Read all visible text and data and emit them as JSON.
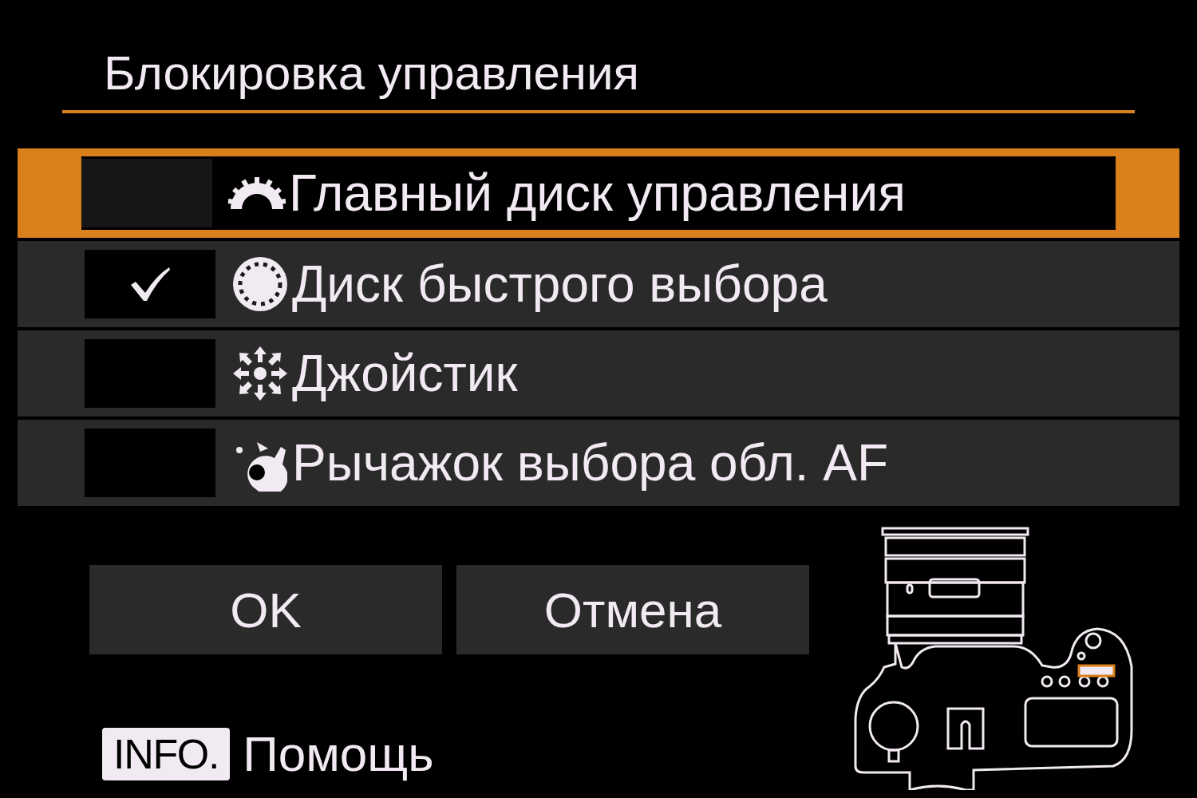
{
  "title": "Блокировка управления",
  "items": [
    {
      "kind": "main-dial",
      "label": "Главный диск управления",
      "selected": true,
      "checked": false
    },
    {
      "kind": "quick-dial",
      "label": "Диск быстрого выбора",
      "selected": false,
      "checked": true
    },
    {
      "kind": "joystick",
      "label": "Джойстик",
      "selected": false,
      "checked": false
    },
    {
      "kind": "af-lever",
      "label": "Рычажок выбора обл. AF",
      "selected": false,
      "checked": false
    }
  ],
  "buttons": [
    "OK",
    "Отмена"
  ],
  "help": {
    "key": "INFO.",
    "label": "Помощь"
  }
}
